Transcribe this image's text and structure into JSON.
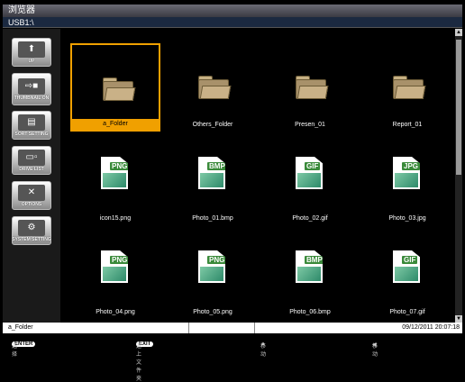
{
  "window": {
    "title": "浏览器"
  },
  "path": "USB1:\\",
  "sidebar": [
    {
      "label": "UP",
      "icon": "folder-up-icon"
    },
    {
      "label": "THUMBNAIL ON",
      "icon": "thumbnail-icon"
    },
    {
      "label": "SORT SETTING",
      "icon": "sort-icon"
    },
    {
      "label": "DRIVE LIST",
      "icon": "drive-icon"
    },
    {
      "label": "OPTIONS",
      "icon": "tools-icon"
    },
    {
      "label": "SYSTEM SETTING",
      "icon": "system-icon"
    }
  ],
  "items": [
    {
      "label": "a_Folder",
      "type": "folder",
      "selected": true
    },
    {
      "label": "Others_Folder",
      "type": "folder"
    },
    {
      "label": "Presen_01",
      "type": "folder"
    },
    {
      "label": "Report_01",
      "type": "folder"
    },
    {
      "label": "icon15.png",
      "type": "file",
      "ext": "PNG"
    },
    {
      "label": "Photo_01.bmp",
      "type": "file",
      "ext": "BMP"
    },
    {
      "label": "Photo_02.gif",
      "type": "file",
      "ext": "GIF"
    },
    {
      "label": "Photo_03.jpg",
      "type": "file",
      "ext": "JPG"
    },
    {
      "label": "Photo_04.png",
      "type": "file",
      "ext": "PNG"
    },
    {
      "label": "Photo_05.png",
      "type": "file",
      "ext": "PNG"
    },
    {
      "label": "Photo_06.bmp",
      "type": "file",
      "ext": "BMP"
    },
    {
      "label": "Photo_07.gif",
      "type": "file",
      "ext": "GIF"
    }
  ],
  "status": {
    "selected": "a_Folder",
    "datetime": "09/12/2011 20:07:18"
  },
  "footer": [
    {
      "key": "ENTER",
      "text": "选择"
    },
    {
      "key": "EXIT",
      "text": "返上 文件夹"
    },
    {
      "key": "▲",
      "text": "移动"
    },
    {
      "key": "◀",
      "text": "移动"
    }
  ],
  "colors": {
    "selection": "#f0a000",
    "title_bg": "#3a3a42"
  }
}
